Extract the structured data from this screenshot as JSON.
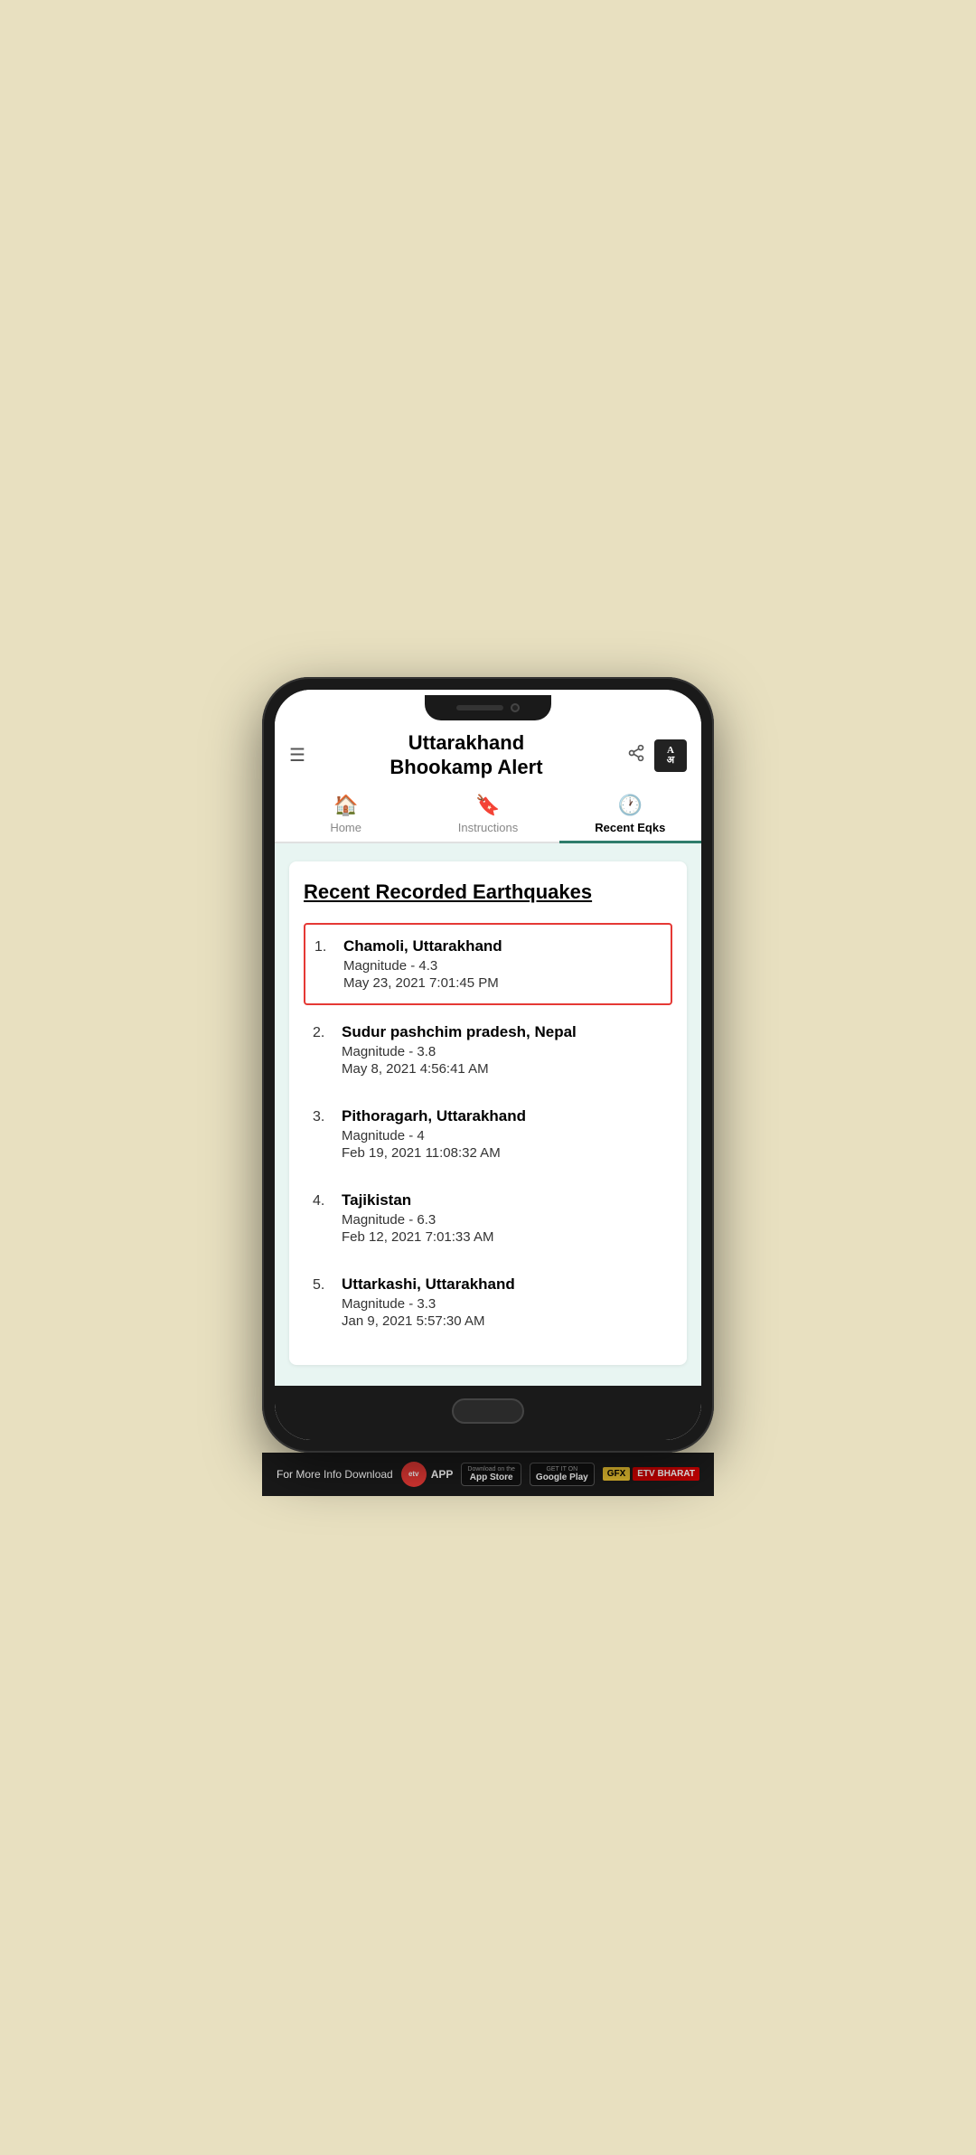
{
  "background_color": "#e8e0c0",
  "header": {
    "menu_icon": "☰",
    "title_line1": "Uttarakhand",
    "title_line2": "Bhookamp Alert",
    "share_icon": "⬆",
    "translate_top": "A",
    "translate_bottom": "अ"
  },
  "tabs": [
    {
      "id": "home",
      "label": "Home",
      "icon": "🏠",
      "active": false
    },
    {
      "id": "instructions",
      "label": "Instructions",
      "icon": "🔖",
      "active": false
    },
    {
      "id": "recent",
      "label": "Recent Eqks",
      "icon": "🕐",
      "active": true
    }
  ],
  "section_title": "Recent Recorded Earthquakes",
  "earthquakes": [
    {
      "number": "1.",
      "location": "Chamoli, Uttarakhand",
      "magnitude": "Magnitude - 4.3",
      "date": "May 23, 2021 7:01:45 PM",
      "highlighted": true
    },
    {
      "number": "2.",
      "location": "Sudur pashchim pradesh, Nepal",
      "magnitude": "Magnitude - 3.8",
      "date": "May 8, 2021 4:56:41 AM",
      "highlighted": false
    },
    {
      "number": "3.",
      "location": "Pithoragarh, Uttarakhand",
      "magnitude": "Magnitude - 4",
      "date": "Feb 19, 2021 11:08:32 AM",
      "highlighted": false
    },
    {
      "number": "4.",
      "location": "Tajikistan",
      "magnitude": "Magnitude - 6.3",
      "date": "Feb 12, 2021 7:01:33 AM",
      "highlighted": false
    },
    {
      "number": "5.",
      "location": "Uttarkashi, Uttarakhand",
      "magnitude": "Magnitude - 3.3",
      "date": "Jan 9, 2021 5:57:30 AM",
      "highlighted": false
    }
  ],
  "bottom_banner": {
    "text": "For More Info Download",
    "app_label": "APP",
    "app_store_line1": "Download on the",
    "app_store_line2": "App Store",
    "google_play_line1": "GET IT ON",
    "google_play_line2": "Google Play",
    "gfx": "GFX",
    "etv": "ETV BHARAT"
  }
}
